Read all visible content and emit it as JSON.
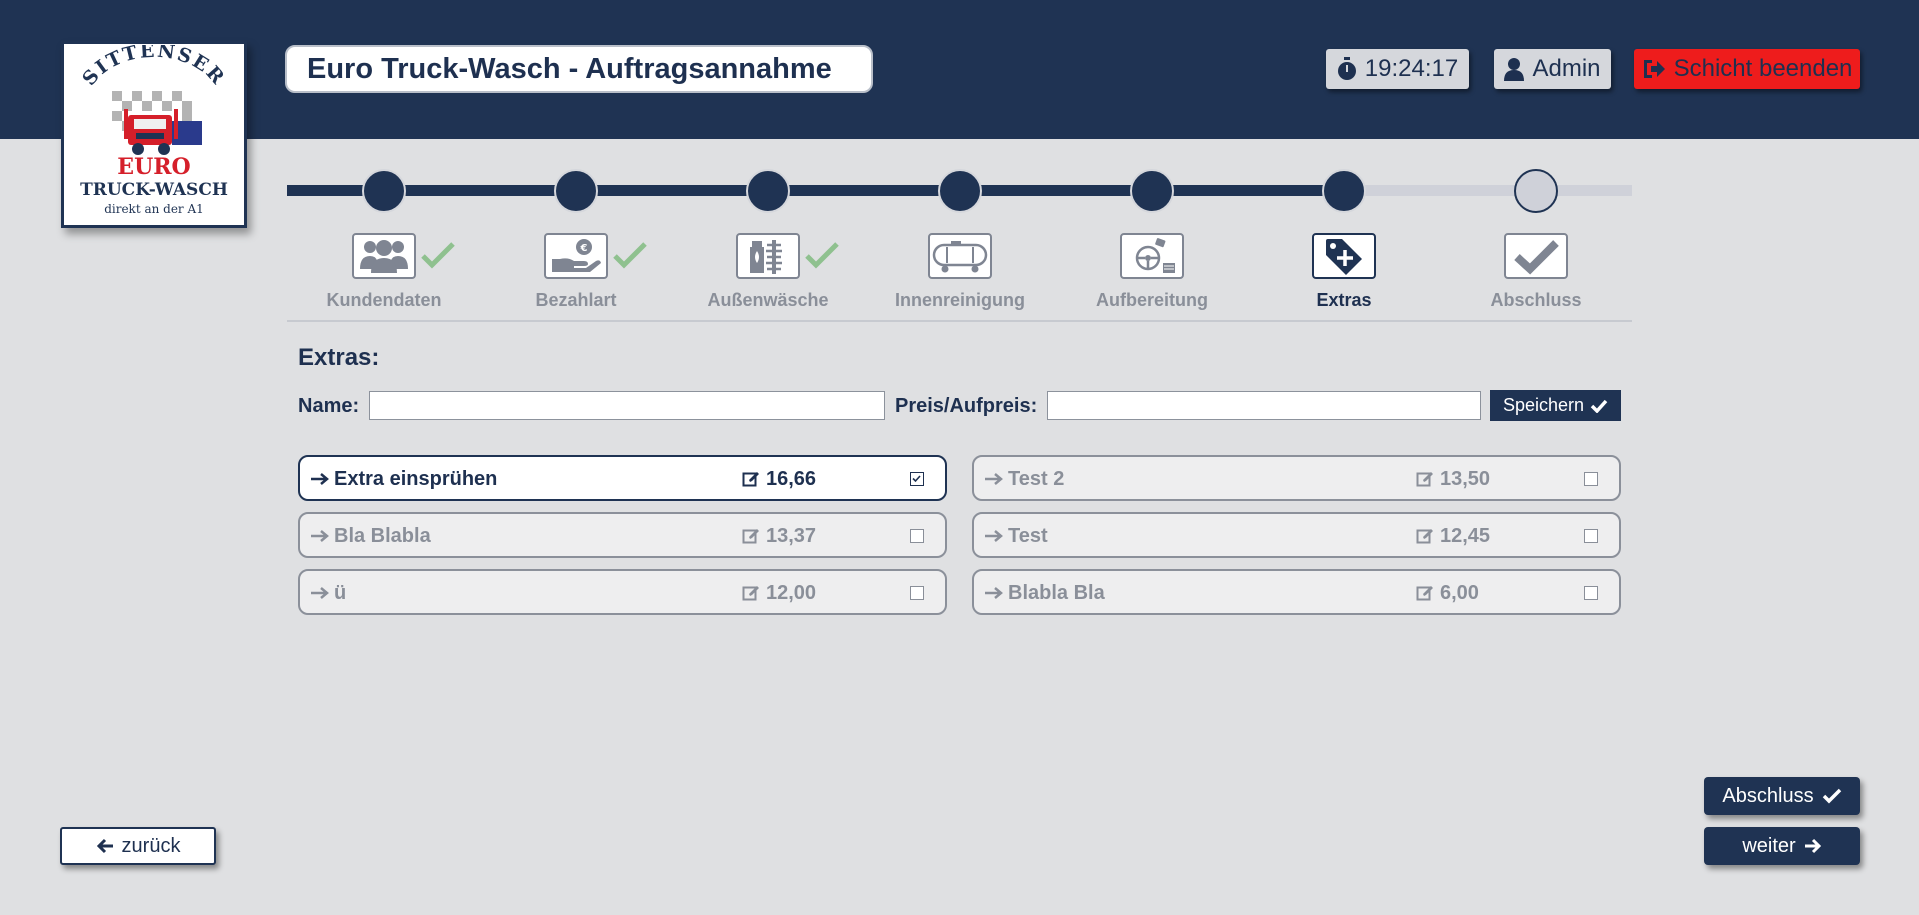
{
  "header": {
    "title": "Euro Truck-Wasch - Auftragsannahme",
    "timer": "19:24:17",
    "user": "Admin",
    "logout_label": "Schicht beenden",
    "colors": {
      "bar": "#1f3353",
      "logout": "#ee1c1c"
    }
  },
  "logo": {
    "line1": "SITTENSER",
    "line2": "EURO",
    "line3": "TRUCK-WASCH",
    "line4": "direkt an der A1"
  },
  "steps": [
    {
      "label": "Kundendaten",
      "icon": "users-icon",
      "done": true
    },
    {
      "label": "Bezahlart",
      "icon": "hand-euro-icon",
      "done": true
    },
    {
      "label": "Außenwäsche",
      "icon": "exterior-wash-icon",
      "done": true
    },
    {
      "label": "Innenreinigung",
      "icon": "tanker-icon",
      "done": false
    },
    {
      "label": "Aufbereitung",
      "icon": "interior-care-icon",
      "done": false
    },
    {
      "label": "Extras",
      "icon": "tag-plus-icon",
      "done": false,
      "active": true
    },
    {
      "label": "Abschluss",
      "icon": "checkmark-icon",
      "done": false
    }
  ],
  "extras": {
    "title": "Extras:",
    "name_label": "Name:",
    "name_value": "",
    "price_label": "Preis/Aufpreis:",
    "price_value": "",
    "save_label": "Speichern",
    "items": [
      {
        "name": "Extra einsprühen",
        "price": "16,66",
        "selected": true
      },
      {
        "name": "Test 2",
        "price": "13,50",
        "selected": false
      },
      {
        "name": "Bla Blabla",
        "price": "13,37",
        "selected": false
      },
      {
        "name": "Test",
        "price": "12,45",
        "selected": false
      },
      {
        "name": "ü",
        "price": "12,00",
        "selected": false
      },
      {
        "name": "Blabla Bla",
        "price": "6,00",
        "selected": false
      }
    ]
  },
  "nav": {
    "back_label": "zurück",
    "finish_label": "Abschluss",
    "next_label": "weiter"
  }
}
